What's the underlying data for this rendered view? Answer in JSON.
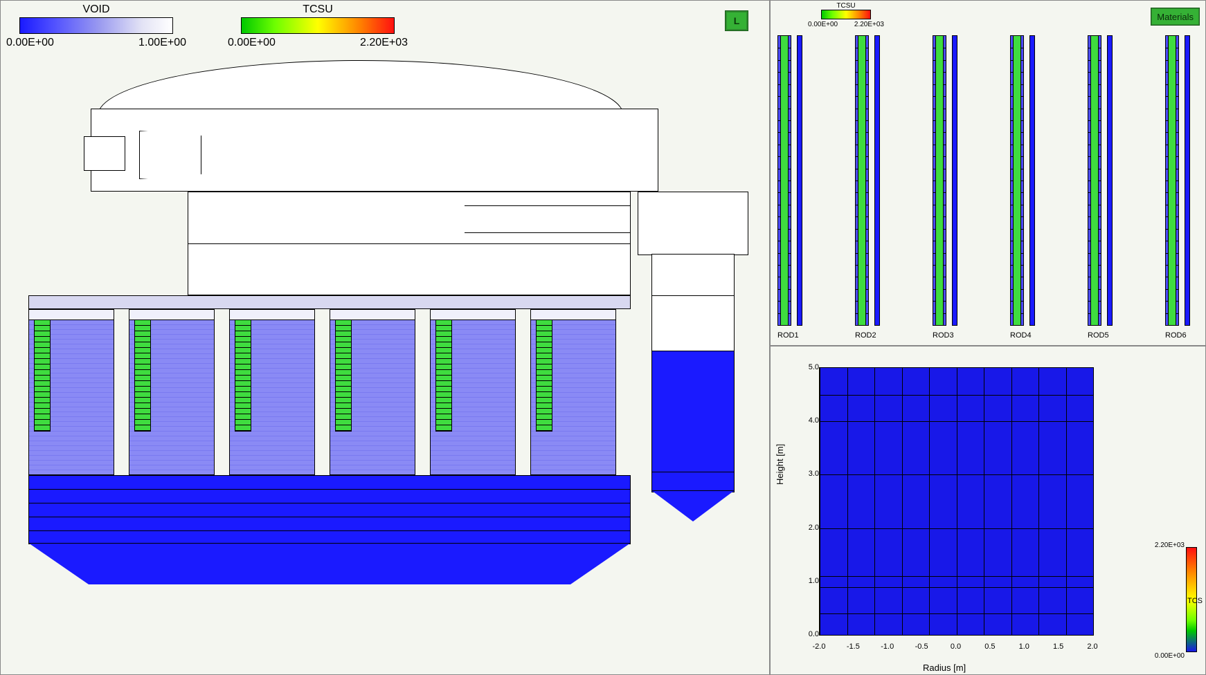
{
  "main_view": {
    "legends": {
      "void": {
        "title": "VOID",
        "min": "0.00E+00",
        "max": "1.00E+00"
      },
      "tcsu": {
        "title": "TCSU",
        "min": "0.00E+00",
        "max": "2.20E+03"
      }
    },
    "button_l": "L"
  },
  "rods_view": {
    "legend": {
      "title": "TCSU",
      "min": "0.00E+00",
      "max": "2.20E+03"
    },
    "button_materials": "Materials",
    "labels": [
      "ROD1",
      "ROD2",
      "ROD3",
      "ROD4",
      "ROD5",
      "ROD6"
    ]
  },
  "chart_data": {
    "type": "heatmap",
    "title": "",
    "xlabel": "Radius [m]",
    "ylabel": "Height [m]",
    "colorbar_label": "TCS",
    "colorbar_min": "0.00E+00",
    "colorbar_max": "2.20E+03",
    "x_ticks": [
      -2.0,
      -1.5,
      -1.0,
      -0.5,
      0.0,
      0.5,
      1.0,
      1.5,
      2.0
    ],
    "y_ticks": [
      0.0,
      1.0,
      2.0,
      3.0,
      4.0,
      5.0
    ],
    "x_range": [
      -2.0,
      2.0
    ],
    "y_range": [
      0.0,
      5.0
    ],
    "field_value_estimate": 0.0,
    "note": "uniform low (blue) field across domain; internal grid at roughly x=[-2,-1.6,-1.2,-0.8,-0.4,0,0.4,0.8,1.2,1.6,2] and y=[0,0.4,0.9,1.1,2.0,3.0,4.0,4.5]"
  }
}
